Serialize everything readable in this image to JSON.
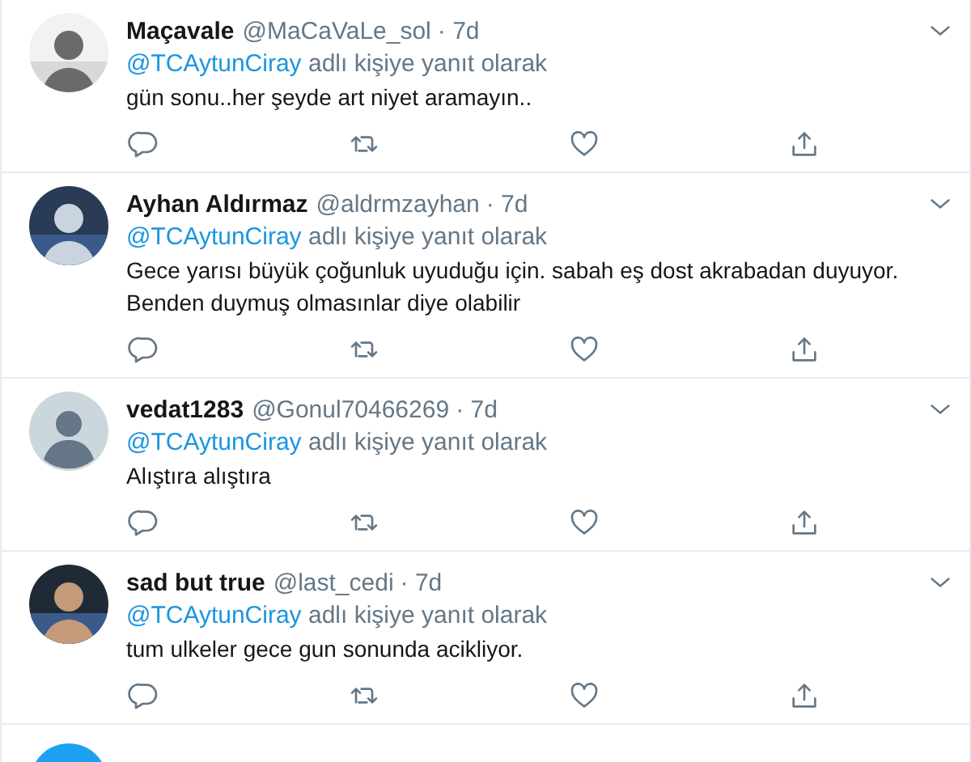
{
  "tweets": [
    {
      "name": "Maçavale",
      "handle": "@MaCaVaLe_sol",
      "time": "· 7d",
      "reply_to": "@TCAytunCiray",
      "reply_suffix": "adlı kişiye yanıt olarak",
      "text": "gün sonu..her şeyde art niyet aramayın.."
    },
    {
      "name": "Ayhan Aldırmaz",
      "handle": "@aldrmzayhan",
      "time": "· 7d",
      "reply_to": "@TCAytunCiray",
      "reply_suffix": "adlı kişiye yanıt olarak",
      "text": "Gece yarısı büyük çoğunluk uyuduğu için. sabah eş dost akrabadan duyuyor. Benden duymuş olmasınlar diye olabilir"
    },
    {
      "name": "vedat1283",
      "handle": "@Gonul70466269",
      "time": "· 7d",
      "reply_to": "@TCAytunCiray",
      "reply_suffix": "adlı kişiye yanıt olarak",
      "text": "Alıştıra alıştıra",
      "avatar": {
        "kind": "default"
      }
    },
    {
      "name": "sad but true",
      "handle": "@last_cedi",
      "time": "· 7d",
      "reply_to": "@TCAytunCiray",
      "reply_suffix": "adlı kişiye yanıt olarak",
      "text": "tum ulkeler gece gun sonunda acikliyor."
    }
  ]
}
